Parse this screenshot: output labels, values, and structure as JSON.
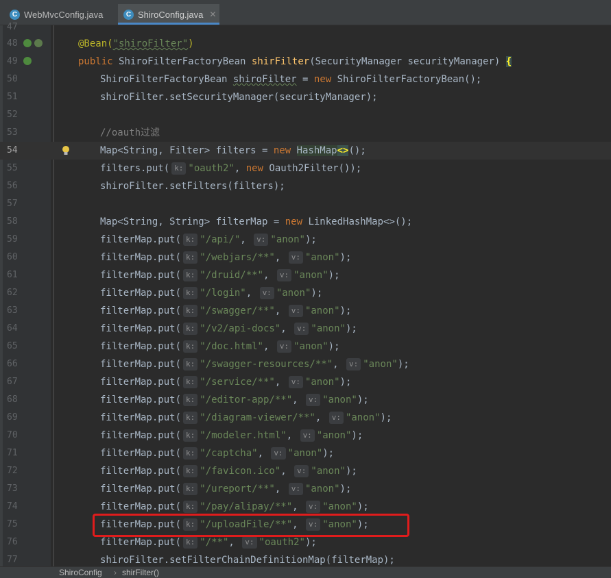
{
  "tabs": [
    {
      "label": "WebMvcConfig.java",
      "active": false,
      "icon": "java-class-icon"
    },
    {
      "label": "ShiroConfig.java",
      "active": true,
      "icon": "java-class-icon"
    }
  ],
  "editor": {
    "lines": [
      {
        "num": "47"
      },
      {
        "num": "48"
      },
      {
        "num": "49"
      },
      {
        "num": "50"
      },
      {
        "num": "51"
      },
      {
        "num": "52"
      },
      {
        "num": "53"
      },
      {
        "num": "54"
      },
      {
        "num": "55"
      },
      {
        "num": "56"
      },
      {
        "num": "57"
      },
      {
        "num": "58"
      },
      {
        "num": "59"
      },
      {
        "num": "60"
      },
      {
        "num": "61"
      },
      {
        "num": "62"
      },
      {
        "num": "63"
      },
      {
        "num": "64"
      },
      {
        "num": "65"
      },
      {
        "num": "66"
      },
      {
        "num": "67"
      },
      {
        "num": "68"
      },
      {
        "num": "69"
      },
      {
        "num": "70"
      },
      {
        "num": "71"
      },
      {
        "num": "72"
      },
      {
        "num": "73"
      },
      {
        "num": "74"
      },
      {
        "num": "75"
      },
      {
        "num": "76"
      },
      {
        "num": "77"
      }
    ],
    "code": {
      "l48_ann": "@Bean(",
      "l48_str": "\"shiroFilter\"",
      "l48_close": ")",
      "l49_kw": "public ",
      "l49_type": "ShiroFilterFactoryBean ",
      "l49_fn": "shirFilter",
      "l49_rest": "(SecurityManager securityManager) ",
      "l49_brace": "{",
      "l50_a": "ShiroFilterFactoryBean ",
      "l50_var": "shiroFilter",
      "l50_b": " = ",
      "l50_kw": "new ",
      "l50_c": "ShiroFilterFactoryBean();",
      "l51": "shiroFilter.setSecurityManager(securityManager);",
      "l53": "//oauth过滤",
      "l54_a": "Map<String, Filter> filters = ",
      "l54_kw": "new ",
      "l54_hm": "HashMap",
      "l54_dia": "<>",
      "l54_b": "();",
      "l55_a": "filters.put(",
      "l55_k": "k:",
      "l55_str": "\"oauth2\"",
      "l55_b": ", ",
      "l55_kw": "new ",
      "l55_c": "Oauth2Filter());",
      "l56": "shiroFilter.setFilters(filters);",
      "l58_a": "Map<String, String> filterMap = ",
      "l58_kw": "new ",
      "l58_b": "LinkedHashMap<>();",
      "l77": "shiroFilter.setFilterChainDefinitionMap(filterMap);"
    },
    "put_call": "filterMap.put(",
    "key_hint": "k:",
    "val_hint": "v:",
    "comma": ", ",
    "put_end": ");",
    "entries": [
      {
        "key": "\"/api/\"",
        "val": "\"anon\""
      },
      {
        "key": "\"/webjars/**\"",
        "val": "\"anon\""
      },
      {
        "key": "\"/druid/**\"",
        "val": "\"anon\""
      },
      {
        "key": "\"/login\"",
        "val": "\"anon\""
      },
      {
        "key": "\"/swagger/**\"",
        "val": "\"anon\""
      },
      {
        "key": "\"/v2/api-docs\"",
        "val": "\"anon\""
      },
      {
        "key": "\"/doc.html\"",
        "val": "\"anon\""
      },
      {
        "key": "\"/swagger-resources/**\"",
        "val": "\"anon\""
      },
      {
        "key": "\"/service/**\"",
        "val": "\"anon\""
      },
      {
        "key": "\"/editor-app/**\"",
        "val": "\"anon\""
      },
      {
        "key": "\"/diagram-viewer/**\"",
        "val": "\"anon\""
      },
      {
        "key": "\"/modeler.html\"",
        "val": "\"anon\""
      },
      {
        "key": "\"/captcha\"",
        "val": "\"anon\""
      },
      {
        "key": "\"/favicon.ico\"",
        "val": "\"anon\""
      },
      {
        "key": "\"/ureport/**\"",
        "val": "\"anon\""
      },
      {
        "key": "\"/pay/alipay/**\"",
        "val": "\"anon\""
      },
      {
        "key": "\"/uploadFile/**\"",
        "val": "\"anon\""
      },
      {
        "key": "\"/**\"",
        "val": "\"oauth2\""
      }
    ]
  },
  "breadcrumb": {
    "items": [
      "ShiroConfig",
      "shirFilter()"
    ],
    "separator": "›"
  },
  "colors": {
    "highlight_box": "#e01c1c",
    "editor_bg": "#2b2b2b",
    "keyword": "#cc7832",
    "string": "#6a8759"
  }
}
